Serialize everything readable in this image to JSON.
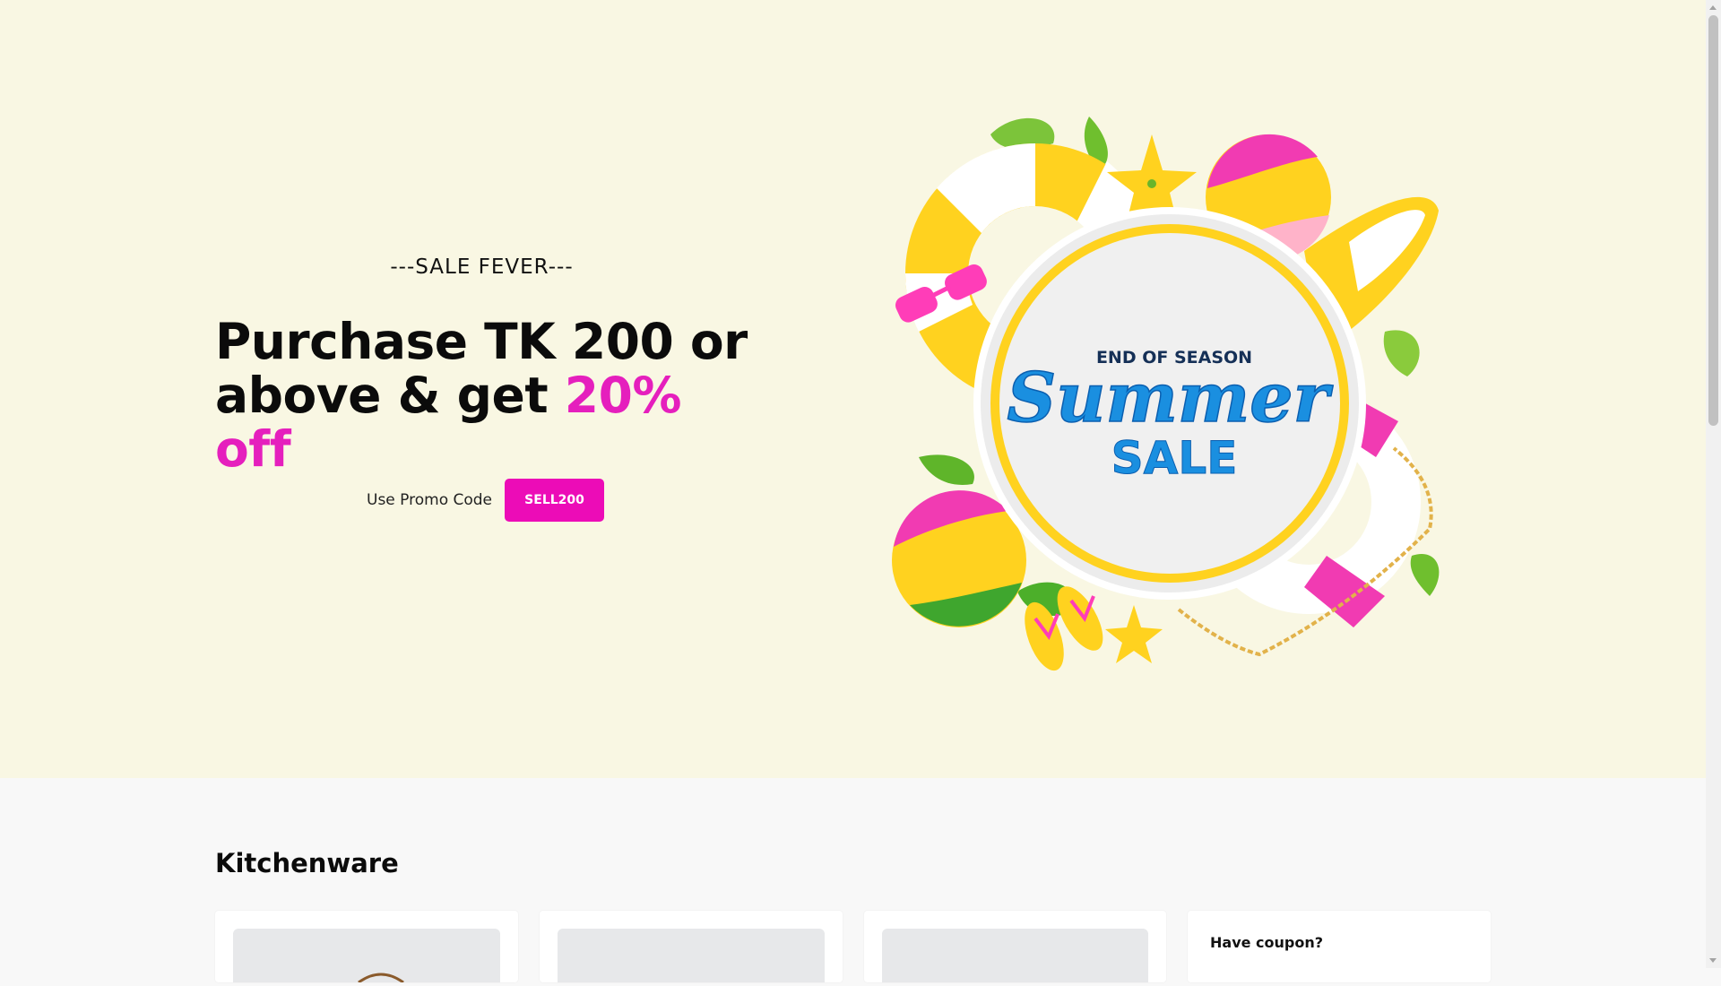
{
  "hero": {
    "kicker": "---SALE FEVER---",
    "headline_line1": "Purchase TK 200 or",
    "headline_line2_prefix": "above & get ",
    "headline_accent": "20% off",
    "promo_label": "Use Promo Code",
    "promo_code": "SELL200",
    "art": {
      "top_text": "END OF SEASON",
      "script_text": "Summer",
      "bottom_text": "SALE"
    }
  },
  "section": {
    "title": "Kitchenware"
  },
  "coupon": {
    "title": "Have coupon?"
  },
  "colors": {
    "hero_bg": "#f9f7e3",
    "accent": "#e51fbd",
    "button": "#ec0cb7",
    "sale_blue": "#1a8fe0"
  }
}
